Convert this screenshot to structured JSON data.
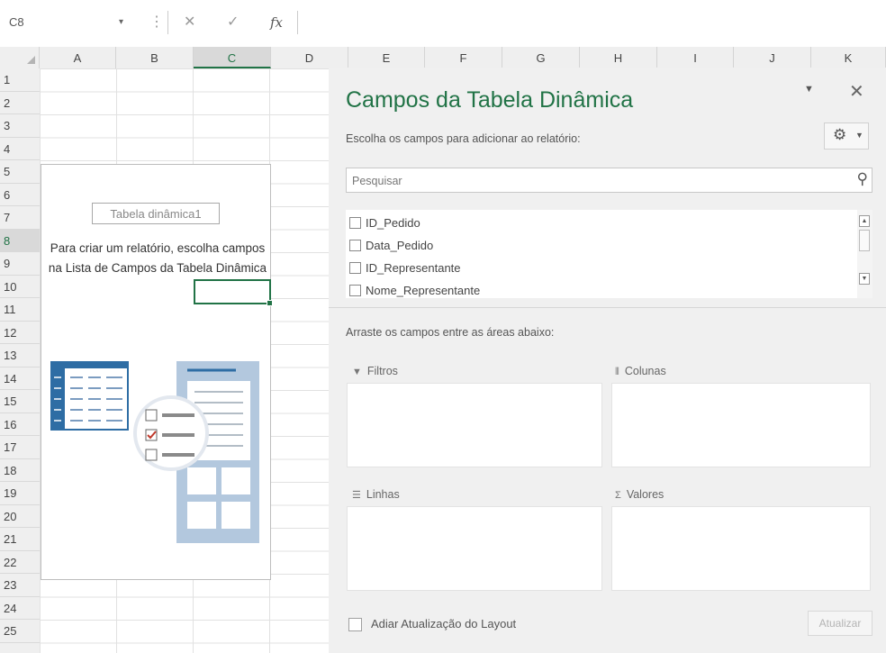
{
  "formula_bar": {
    "name_box": "C8",
    "dropdown_glyph": "▾",
    "grip_glyph": "⋮",
    "cancel_glyph": "✕",
    "enter_glyph": "✓",
    "fx_label": "fx",
    "formula_value": ""
  },
  "columns": [
    "A",
    "B",
    "C",
    "D",
    "E",
    "F",
    "G",
    "H",
    "I",
    "J",
    "K"
  ],
  "selected_column": "C",
  "rows": [
    "1",
    "2",
    "3",
    "4",
    "5",
    "6",
    "7",
    "8",
    "9",
    "10",
    "11",
    "12",
    "13",
    "14",
    "15",
    "16",
    "17",
    "18",
    "19",
    "20",
    "21",
    "22",
    "23",
    "24",
    "25"
  ],
  "selected_row": "8",
  "pivot_placeholder": {
    "name": "Tabela dinâmica1",
    "instructions": "Para criar um relatório, escolha campos na Lista de Campos da Tabela Dinâmica"
  },
  "field_pane": {
    "title": "Campos da Tabela Dinâmica",
    "menu_glyph": "▼",
    "close_glyph": "✕",
    "choose_label": "Escolha os campos para adicionar ao relatório:",
    "settings_icon": "gear-icon",
    "search_placeholder": "Pesquisar",
    "fields": [
      {
        "label": "ID_Pedido",
        "checked": false
      },
      {
        "label": "Data_Pedido",
        "checked": false
      },
      {
        "label": "ID_Representante",
        "checked": false
      },
      {
        "label": "Nome_Representante",
        "checked": false
      }
    ],
    "drag_label": "Arraste os campos entre as áreas abaixo:",
    "areas": {
      "filters": "Filtros",
      "columns": "Colunas",
      "rows": "Linhas",
      "values": "Valores"
    },
    "defer_label": "Adiar Atualização do Layout",
    "update_button": "Atualizar"
  },
  "colors": {
    "accent": "#217346",
    "illustration_blue": "#2e6da4",
    "illustration_light": "#b3c8de",
    "check_red": "#c0392b"
  }
}
